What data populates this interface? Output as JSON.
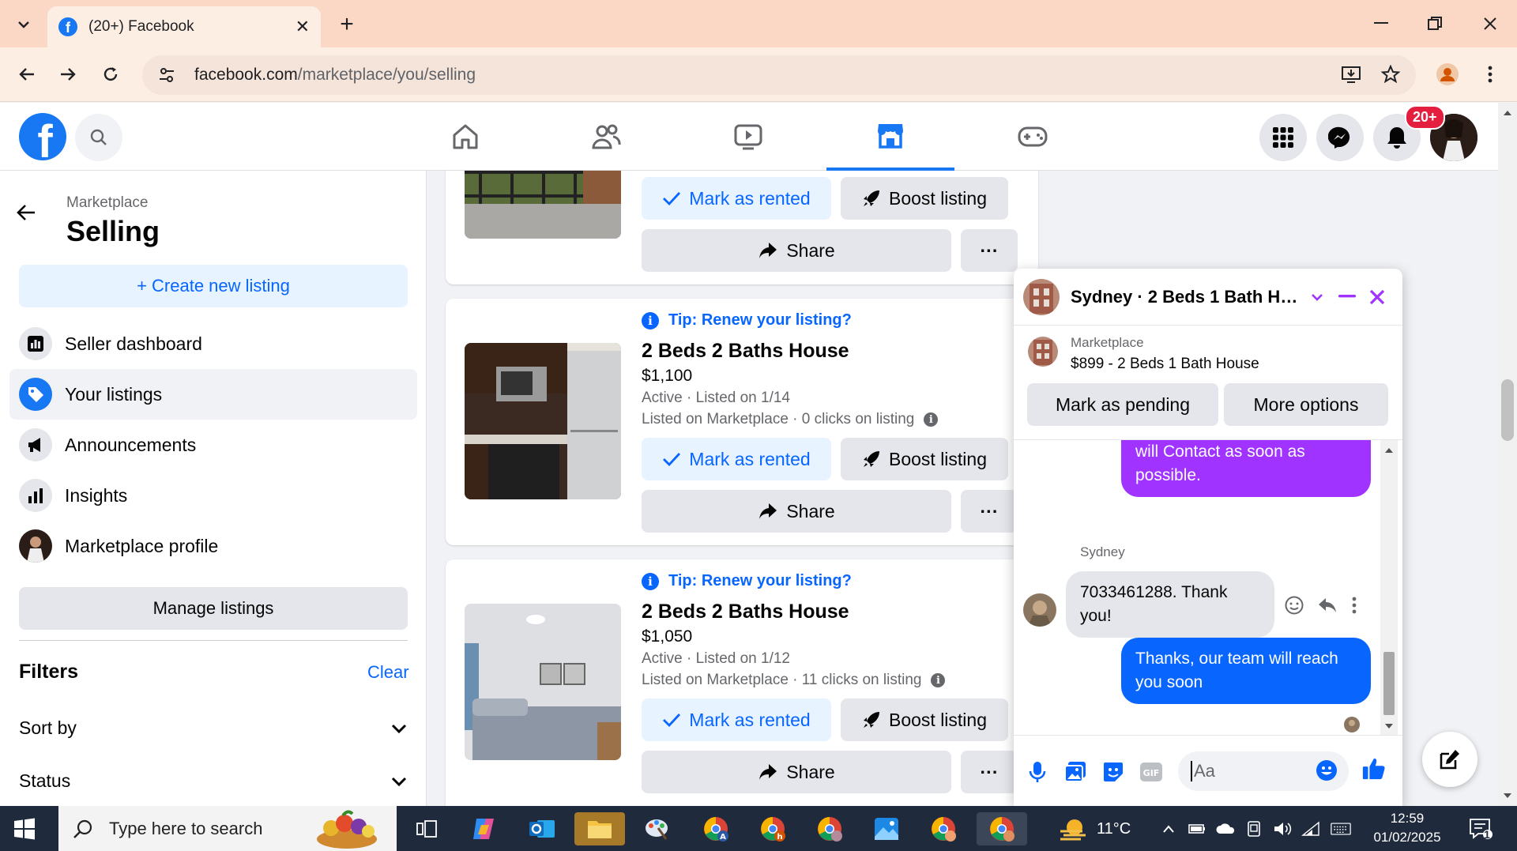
{
  "browser": {
    "tab_title": "(20+) Facebook",
    "url_host": "facebook.com",
    "url_path": "/marketplace/you/selling"
  },
  "header": {
    "notification_badge": "20+"
  },
  "sidebar": {
    "breadcrumb": "Marketplace",
    "title": "Selling",
    "create_label": "+ Create new listing",
    "items": [
      {
        "label": "Seller dashboard"
      },
      {
        "label": "Your listings"
      },
      {
        "label": "Announcements"
      },
      {
        "label": "Insights"
      },
      {
        "label": "Marketplace profile"
      }
    ],
    "manage_label": "Manage listings",
    "filters_label": "Filters",
    "clear_label": "Clear",
    "sort_label": "Sort by",
    "status_label": "Status"
  },
  "listings": [
    {
      "mark_label": "Mark as rented",
      "boost_label": "Boost listing",
      "share_label": "Share",
      "more_label": "···"
    },
    {
      "tip": "Tip: Renew your listing?",
      "title": "2 Beds 2 Baths House",
      "price": "$1,100",
      "status": "Active · Listed on 1/14",
      "clicks": "Listed on Marketplace · 0 clicks on listing",
      "mark_label": "Mark as rented",
      "boost_label": "Boost listing",
      "share_label": "Share",
      "more_label": "···"
    },
    {
      "tip": "Tip: Renew your listing?",
      "title": "2 Beds 2 Baths House",
      "price": "$1,050",
      "status": "Active · Listed on 1/12",
      "clicks": "Listed on Marketplace · 11 clicks on listing",
      "mark_label": "Mark as rented",
      "boost_label": "Boost listing",
      "share_label": "Share",
      "more_label": "···"
    }
  ],
  "chat": {
    "title": "Sydney · 2 Beds 1 Bath Ho...",
    "context_label": "Marketplace",
    "context_title": "$899 - 2 Beds 1 Bath House",
    "pending_label": "Mark as pending",
    "options_label": "More options",
    "messages": [
      {
        "text": "will Contact as soon as possible."
      },
      {
        "sender": "Sydney",
        "text": "7033461288. Thank you!"
      },
      {
        "text": "Thanks, our team will reach you soon"
      }
    ],
    "input_placeholder": "Aa"
  },
  "taskbar": {
    "search_placeholder": "Type here to search",
    "temperature": "11°C",
    "time": "12:59",
    "date": "01/02/2025",
    "notif_count": "1"
  }
}
